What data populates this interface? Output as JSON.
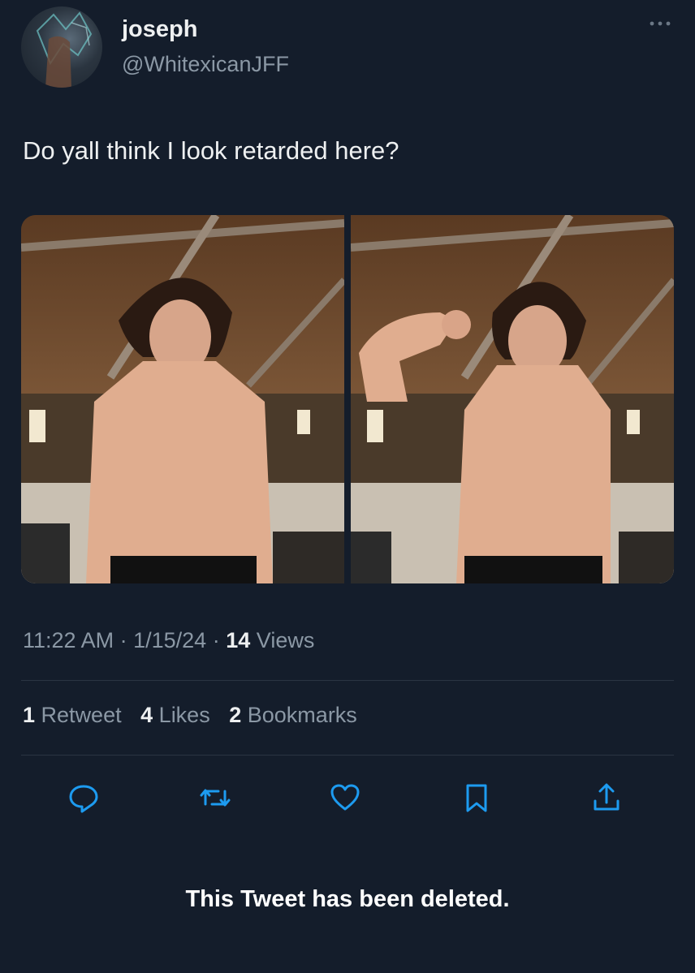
{
  "author": {
    "display_name": "joseph",
    "handle": "@WhitexicanJFF"
  },
  "tweet": {
    "text": "Do yall think I look retarded here?"
  },
  "meta": {
    "time": "11:22 AM",
    "date": "1/15/24",
    "views_count": "14",
    "views_label": "Views",
    "separator": "·"
  },
  "stats": [
    {
      "count": "1",
      "label": "Retweet"
    },
    {
      "count": "4",
      "label": "Likes"
    },
    {
      "count": "2",
      "label": "Bookmarks"
    }
  ],
  "actions": [
    "reply-icon",
    "retweet-icon",
    "like-icon",
    "bookmark-icon",
    "share-icon"
  ],
  "notice": "This Tweet has been deleted.",
  "colors": {
    "background": "#141d2b",
    "primary_text": "#eef0f1",
    "secondary_text": "#8b98a5",
    "icon": "#1d9bf0"
  }
}
